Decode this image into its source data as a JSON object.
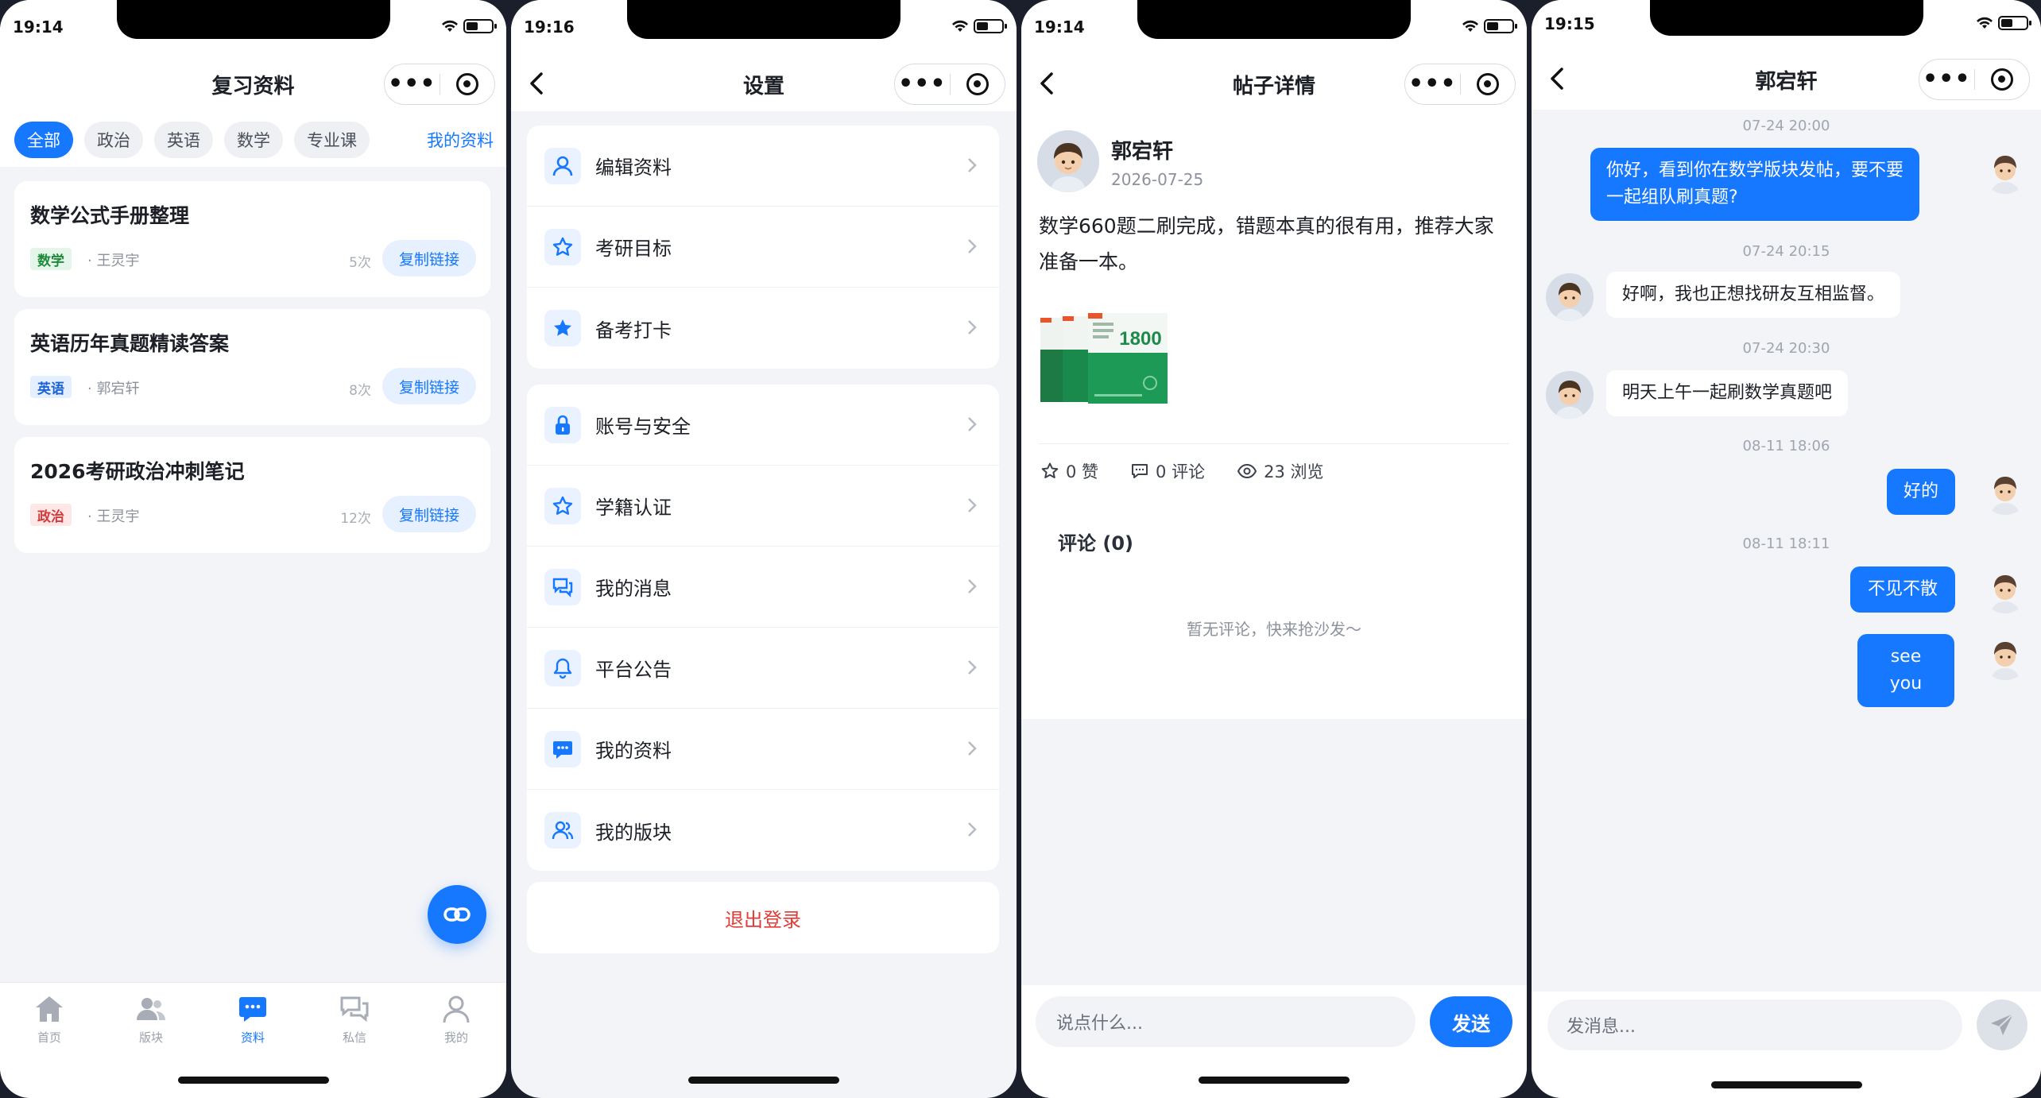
{
  "screen1": {
    "time": "19:14",
    "title": "复习资料",
    "chips": [
      "全部",
      "政治",
      "英语",
      "数学",
      "专业课"
    ],
    "mine_link": "我的资料",
    "cards": [
      {
        "title": "数学公式手册整理",
        "tag": "数学",
        "author": "· 王灵宇",
        "count": "5次",
        "copy": "复制链接"
      },
      {
        "title": "英语历年真题精读答案",
        "tag": "英语",
        "author": "· 郭宕轩",
        "count": "8次",
        "copy": "复制链接"
      },
      {
        "title": "2026考研政治冲刺笔记",
        "tag": "政治",
        "author": "· 王灵宇",
        "count": "12次",
        "copy": "复制链接"
      }
    ],
    "tabs": [
      "首页",
      "版块",
      "资料",
      "私信",
      "我的"
    ],
    "fab_icon": "link-icon"
  },
  "screen2": {
    "time": "19:16",
    "title": "设置",
    "group1": [
      "编辑资料",
      "考研目标",
      "备考打卡"
    ],
    "group2": [
      "账号与安全",
      "学籍认证",
      "我的消息",
      "平台公告",
      "我的资料",
      "我的版块"
    ],
    "logout": "退出登录"
  },
  "screen3": {
    "time": "19:14",
    "title": "帖子详情",
    "author": "郭宕轩",
    "date": "2026-07-25",
    "content": "数学660题二刷完成，错题本真的很有用，推荐大家准备一本。",
    "image_text": "1800",
    "likes": "0 赞",
    "comments": "0 评论",
    "views": "23 浏览",
    "comments_title": "评论 (0)",
    "empty_comments": "暂无评论，快来抢沙发～",
    "input_placeholder": "说点什么...",
    "send": "发送"
  },
  "screen4": {
    "time": "19:15",
    "title": "郭宕轩",
    "messages": [
      {
        "ts": "07-24 20:00",
        "text": "你好，看到你在数学版块发帖，要不要一起组队刷真题?",
        "from": "me"
      },
      {
        "ts": "07-24 20:15",
        "text": "好啊，我也正想找研友互相监督。",
        "from": "them"
      },
      {
        "ts": "07-24 20:30",
        "text": "明天上午一起刷数学真题吧",
        "from": "them"
      },
      {
        "ts": "08-11 18:06",
        "text": "好的",
        "from": "me"
      },
      {
        "ts": "08-11 18:11",
        "text": "不见不散",
        "from": "me"
      },
      {
        "ts": "",
        "text": "see you",
        "from": "me"
      }
    ],
    "input_placeholder": "发消息..."
  },
  "colors": {
    "accent": "#1677ff",
    "danger": "#e53935",
    "background": "#f2f4f8"
  }
}
